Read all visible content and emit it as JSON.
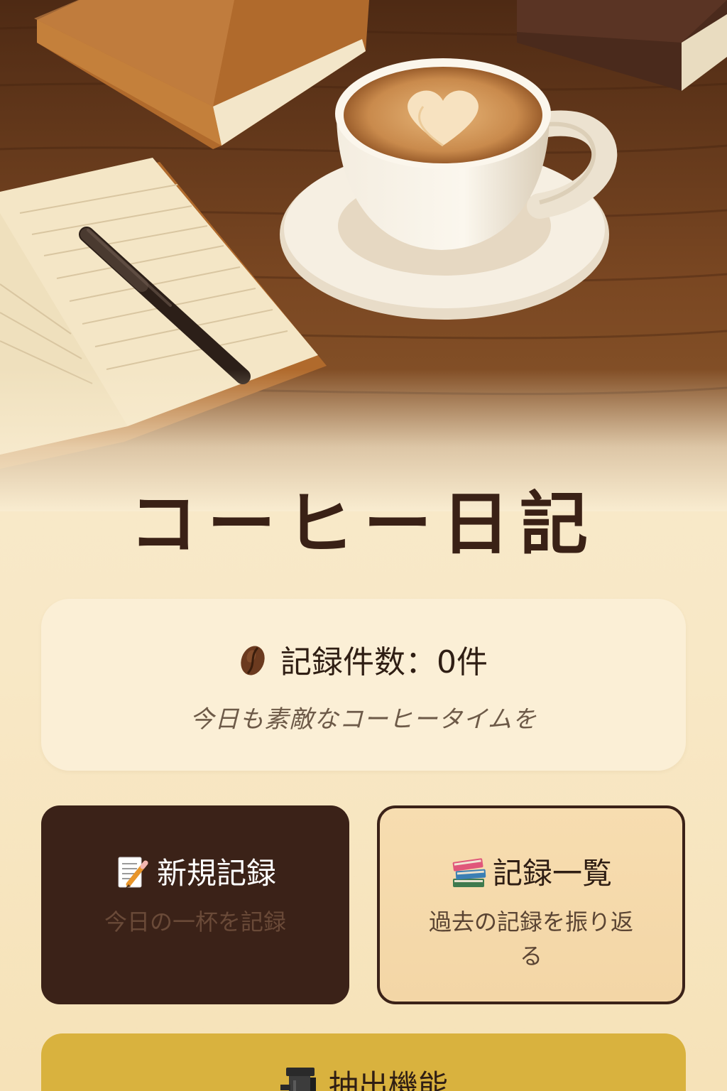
{
  "app": {
    "title": "コーヒー日記"
  },
  "stats": {
    "icon": "coffee-bean-icon",
    "count_text": "記録件数：0件",
    "subtitle": "今日も素敵なコーヒータイムを"
  },
  "actions": {
    "new_record": {
      "icon": "memo-icon",
      "label": "新規記録",
      "subtitle": "今日の一杯を記録"
    },
    "record_list": {
      "icon": "books-icon",
      "label": "記録一覧",
      "subtitle": "過去の記録を振り返る"
    },
    "brew": {
      "icon": "coffee-grinder-icon",
      "label": "抽出機能"
    }
  },
  "colors": {
    "background": "#f8e8c6",
    "title_text": "#3a2116",
    "dark_brown": "#3b2218",
    "card_cream": "#fbefd6",
    "card_tan": "#f5d9aa",
    "accent_mustard": "#d9b23e"
  }
}
